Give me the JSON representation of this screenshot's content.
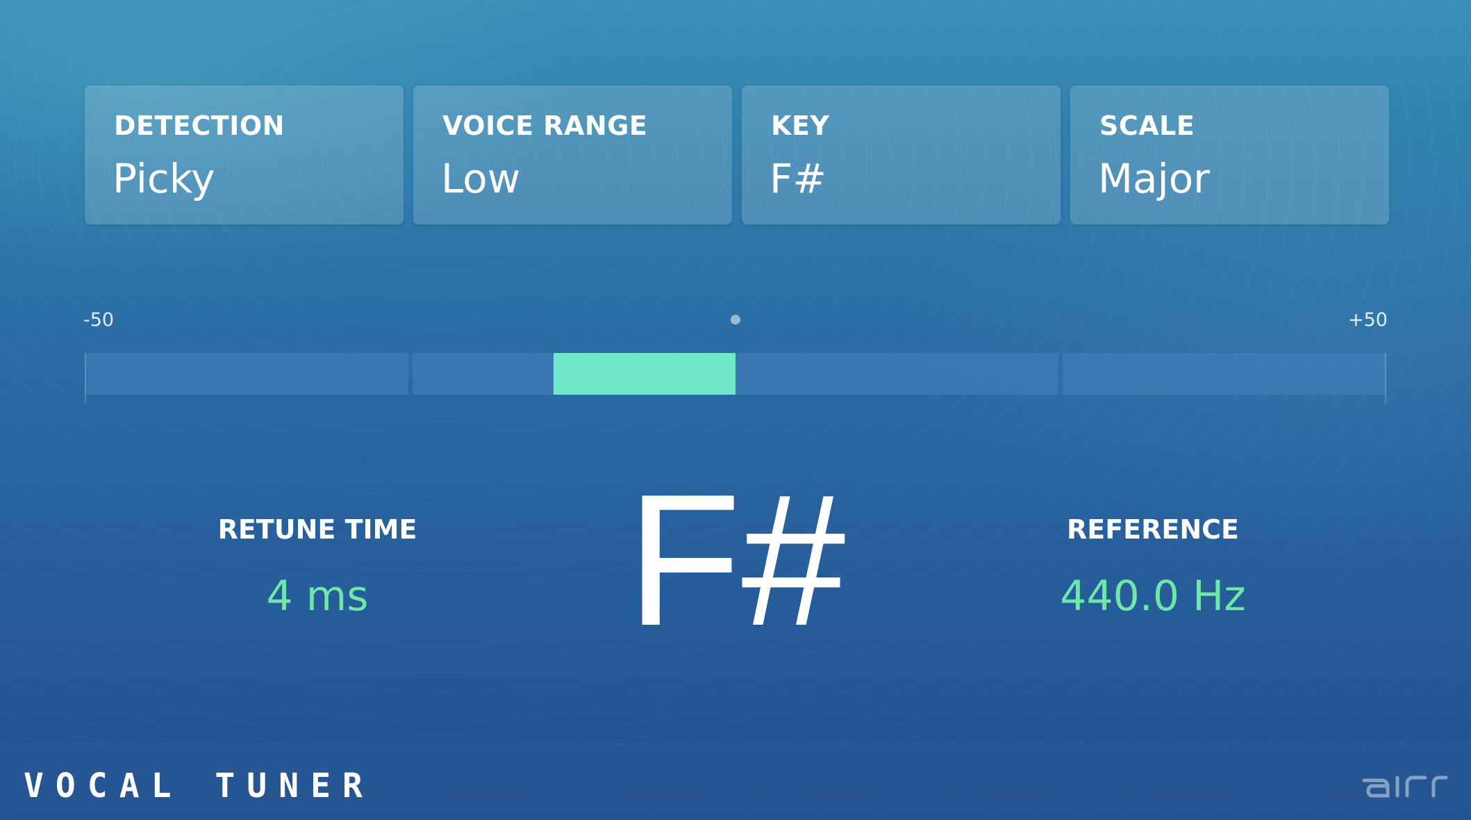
{
  "parameters": [
    {
      "label": "DETECTION",
      "value": "Picky"
    },
    {
      "label": "VOICE RANGE",
      "value": "Low"
    },
    {
      "label": "KEY",
      "value": "F#"
    },
    {
      "label": "SCALE",
      "value": "Major"
    }
  ],
  "meter": {
    "min_label": "-50",
    "max_label": "+50",
    "min": -50,
    "max": 50,
    "deviation_cents": -14,
    "fill_color": "#6ee8c8"
  },
  "retune": {
    "label": "RETUNE TIME",
    "value": "4 ms"
  },
  "detected_note": "F#",
  "reference": {
    "label": "REFERENCE",
    "value": "440.0 Hz"
  },
  "footer": {
    "title": "VOCAL TUNER",
    "brand_logo_text": "air",
    "brand_icon": "air-logo-icon"
  },
  "colors": {
    "accent": "#6ee8a8",
    "meter_fill": "#6ee8c8",
    "background_top": "#3a90b6",
    "background_bottom": "#234f8e"
  }
}
